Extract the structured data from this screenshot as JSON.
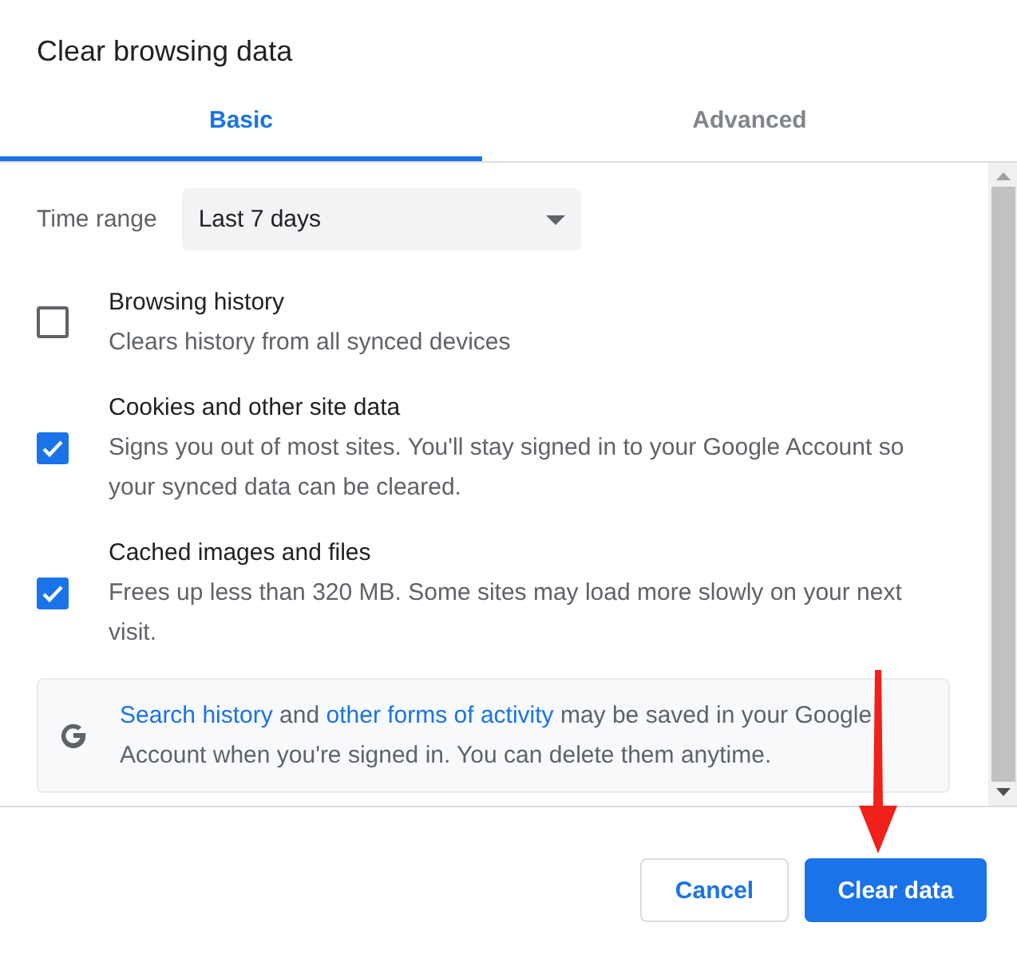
{
  "dialog": {
    "title": "Clear browsing data"
  },
  "tabs": [
    {
      "label": "Basic",
      "selected": true
    },
    {
      "label": "Advanced",
      "selected": false
    }
  ],
  "time_range": {
    "label": "Time range",
    "value": "Last 7 days"
  },
  "options": [
    {
      "title": "Browsing history",
      "description": "Clears history from all synced devices",
      "checked": false
    },
    {
      "title": "Cookies and other site data",
      "description": "Signs you out of most sites. You'll stay signed in to your Google Account so your synced data can be cleared.",
      "checked": true
    },
    {
      "title": "Cached images and files",
      "description": "Frees up less than 320 MB. Some sites may load more slowly on your next visit.",
      "checked": true
    }
  ],
  "info": {
    "parts": [
      {
        "kind": "link",
        "text": "Search history"
      },
      {
        "kind": "text",
        "text": " and "
      },
      {
        "kind": "link",
        "text": "other forms of activity"
      },
      {
        "kind": "text",
        "text": " may be saved in your Google Account when you're signed in. You can delete them anytime."
      }
    ]
  },
  "buttons": [
    {
      "label": "Cancel",
      "kind": "secondary"
    },
    {
      "label": "Clear data",
      "kind": "primary"
    }
  ]
}
